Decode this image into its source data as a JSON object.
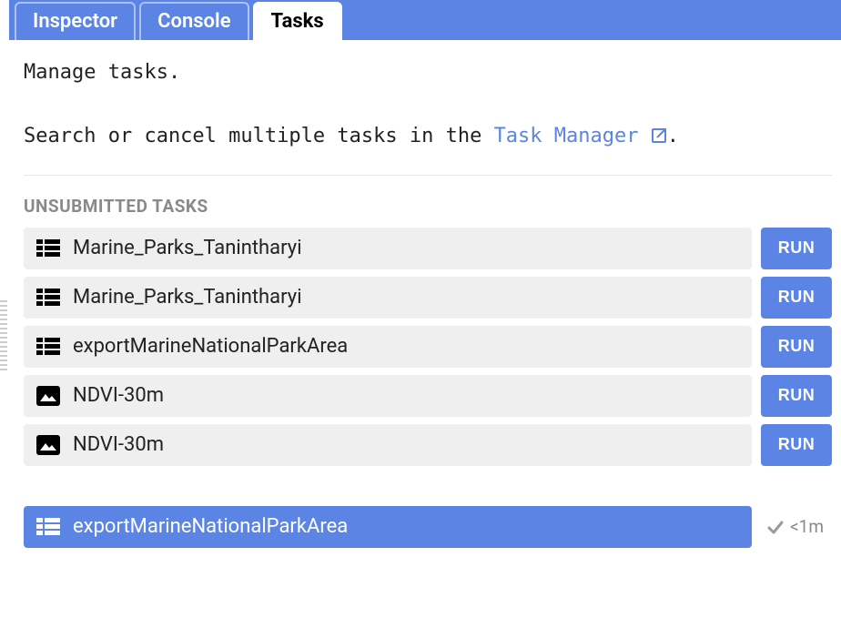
{
  "tabs": {
    "inspector": "Inspector",
    "console": "Console",
    "tasks": "Tasks",
    "active": "tasks"
  },
  "panel": {
    "title_line": "Manage tasks.",
    "help_prefix": "Search or cancel multiple tasks in the ",
    "help_link_text": "Task Manager",
    "help_suffix": "."
  },
  "sections": {
    "unsubmitted_header": "UNSUBMITTED TASKS"
  },
  "run_label": "RUN",
  "unsubmitted": [
    {
      "icon": "table",
      "name": "Marine_Parks_Tanintharyi"
    },
    {
      "icon": "table",
      "name": "Marine_Parks_Tanintharyi"
    },
    {
      "icon": "table",
      "name": "exportMarineNationalParkArea"
    },
    {
      "icon": "image",
      "name": "NDVI-30m"
    },
    {
      "icon": "image",
      "name": "NDVI-30m"
    }
  ],
  "running": [
    {
      "icon": "table",
      "name": "exportMarineNationalParkArea",
      "elapsed": "<1m"
    }
  ]
}
